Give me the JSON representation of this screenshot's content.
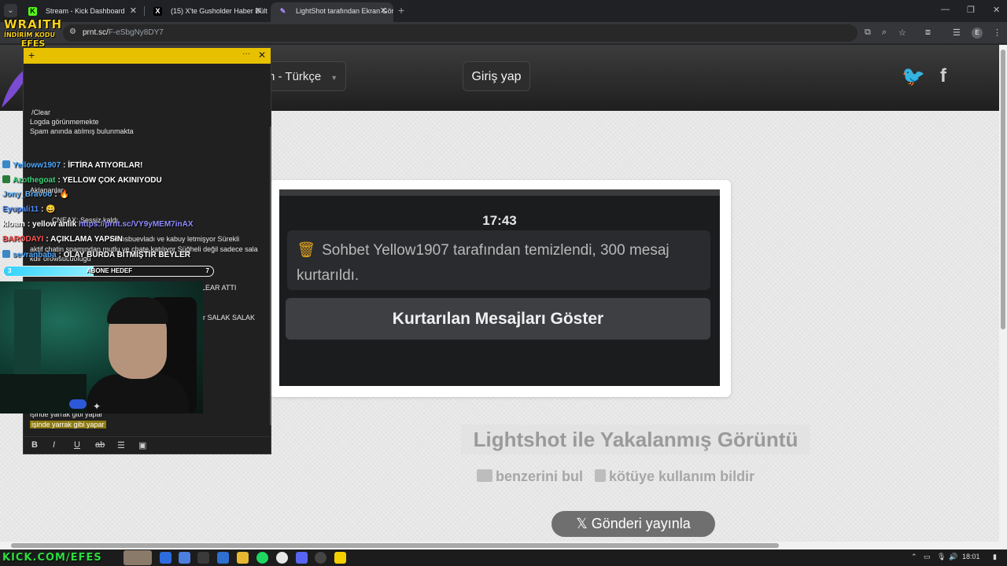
{
  "browser": {
    "tabs": [
      {
        "title": "Stream - Kick Dashboard",
        "favicon": "K",
        "color": "#53fc18",
        "active": false
      },
      {
        "title": "(15) X'te Gusholder Haber Bült",
        "favicon": "X",
        "color": "#000000",
        "active": false
      },
      {
        "title": "LightShot tarafından Ekran Görü",
        "favicon": "feather",
        "color": "#7a4ad0",
        "active": true
      }
    ],
    "url_domain": "prnt.sc/",
    "url_path": "F-eSbgNy8DY7",
    "profile_initial": "E"
  },
  "site": {
    "language_label": "n - Türkçe",
    "login_label": "Giriş yap",
    "screenshot": {
      "time": "17:43",
      "message": "Sohbet Yellow1907 tarafından temizlendi, 300 mesaj kurtarıldı.",
      "button": "Kurtarılan Mesajları Göster"
    },
    "caption": "Lightshot ile Yakalanmış Görüntü",
    "similar_label": "benzerini bul",
    "report_label": "kötüye kullanım bildir",
    "post_label": "Gönderi yayınla"
  },
  "overlay": {
    "brand_line1": "WRAITH",
    "brand_line2": "İNDİRİM KODU",
    "brand_line3": "EFES",
    "sticky_note": {
      "lines": [
        "/Clear",
        "Logda görünmemekte",
        "Spam anında atılmış bulunmakta",
        "Aklananlar",
        "CNEAX: Sessiz kaldı",
        "r orosbuevladı ve kabuy letmişyor Sürekli",
        "aktif chatin spamından mutlu ve chate katılıyor Süğheli değil sadece sala",
        "kdir orowsucuolugu",
        "LEAR ATTI",
        "r SALAK SALAK",
        "işinde yarrak gibi yapar"
      ],
      "highlight": "işinde yarrak gibi yapar"
    },
    "chat": [
      {
        "user": "Yelloww1907",
        "color": "#4aa8ff",
        "text": ": İFTİRA ATIYORLAR!"
      },
      {
        "user": "Azothegoat",
        "color": "#3ad67a",
        "text": ": YELLOW ÇOK AKINIYODU"
      },
      {
        "user": "Jony_Bravoo",
        "color": "#5ab0ff",
        "text": ":"
      },
      {
        "user": "Eyupali11",
        "color": "#4a8cff",
        "text": ":"
      },
      {
        "user": "kloam",
        "color": "#ffffff",
        "text": ": yellow anlık",
        "link": "https://prnt.sc/VY9yMEM7inAX"
      },
      {
        "user": "BARODAYI",
        "color": "#ff5555",
        "text": ": AÇIKLAMA YAPSIN"
      },
      {
        "user": "sevranbaba",
        "color": "#4aa8ff",
        "text": ": OLAY BURDA BİTMİŞTİR BEYLER"
      }
    ],
    "sub_goal": {
      "label": "ABONE HEDEF",
      "current": "3",
      "target": "7",
      "progress": 0.43
    }
  },
  "taskbar": {
    "brand": "KICK.COM/EFES",
    "time": "18:01"
  }
}
